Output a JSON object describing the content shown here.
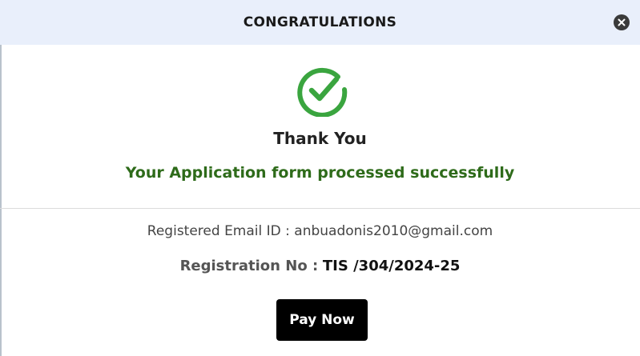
{
  "header": {
    "title": "CONGRATULATIONS",
    "close_icon": "close-icon"
  },
  "status": {
    "icon": "check-circle-icon",
    "heading": "Thank You",
    "message": "Your Application form processed successfully"
  },
  "details": {
    "email_line": "Registered Email ID : anbuadonis2010@gmail.com",
    "registration_label": "Registration No :",
    "registration_value": "TIS /304/2024-25"
  },
  "actions": {
    "pay_label": "Pay Now"
  },
  "colors": {
    "header_bg": "#e9effb",
    "success_green": "#2e6b1a",
    "check_green": "#3aa53f",
    "button_bg": "#000000"
  }
}
